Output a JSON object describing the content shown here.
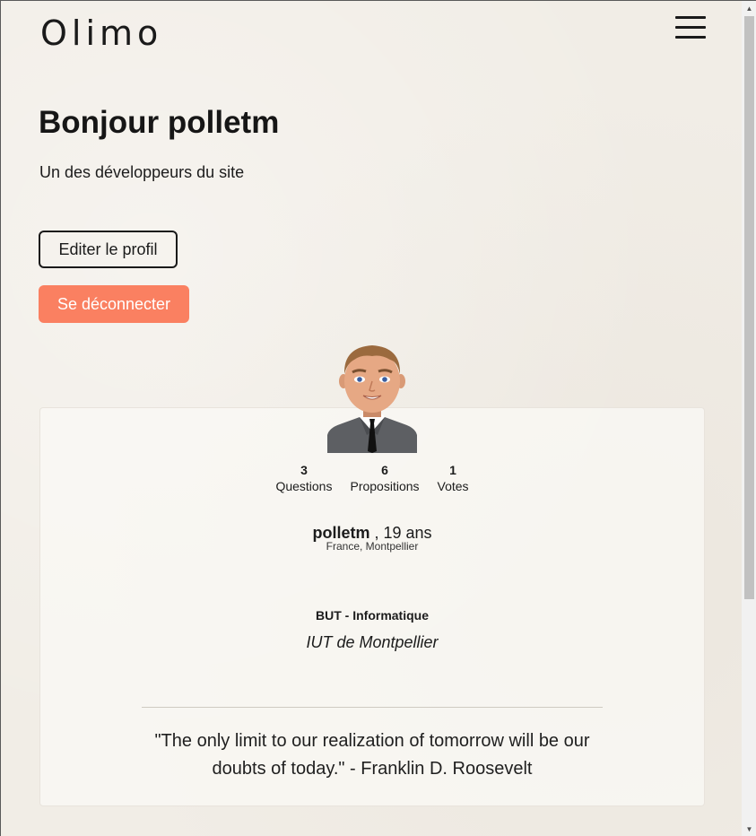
{
  "header": {
    "logo": "Olimo",
    "menu_icon": "hamburger-menu-icon"
  },
  "profile": {
    "greeting": "Bonjour polletm",
    "subtitle": "Un des développeurs du site",
    "edit_label": "Editer le profil",
    "logout_label": "Se déconnecter",
    "avatar_icon": "male-avatar-suit-icon",
    "stats": [
      {
        "value": "3",
        "label": "Questions"
      },
      {
        "value": "6",
        "label": "Propositions"
      },
      {
        "value": "1",
        "label": "Votes"
      }
    ],
    "username": "polletm",
    "age": ", 19 ans",
    "location": "France, Montpellier",
    "degree": "BUT - Informatique",
    "school": "IUT de Montpellier",
    "quote_line1": "\"The only limit to our realization of tomorrow will be our",
    "quote_line2": "doubts of today.\" - Franklin D. Roosevelt"
  },
  "colors": {
    "background": "#f1ede6",
    "logout_button": "#fa8061",
    "text": "#1c1c1c"
  },
  "scrollbar": {
    "up_icon": "scroll-up-arrow-icon",
    "down_icon": "scroll-down-arrow-icon"
  }
}
